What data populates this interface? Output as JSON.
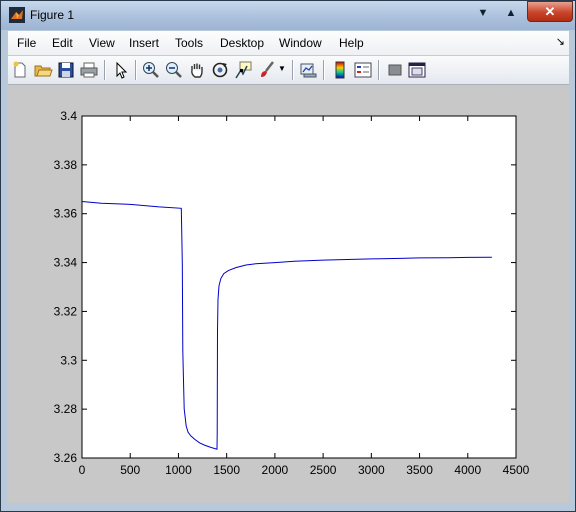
{
  "window": {
    "title": "Figure 1"
  },
  "menu": [
    "File",
    "Edit",
    "View",
    "Insert",
    "Tools",
    "Desktop",
    "Window",
    "Help"
  ],
  "toolbar": {
    "icons": [
      "new-figure-icon",
      "open-file-icon",
      "save-icon",
      "print-icon",
      "pointer-icon",
      "zoom-in-icon",
      "zoom-out-icon",
      "pan-hand-icon",
      "rotate-3d-icon",
      "data-cursor-icon",
      "brush-icon",
      "brush-dropdown-icon",
      "link-plot-icon",
      "insert-colorbar-icon",
      "insert-legend-icon",
      "hide-plot-tools-icon",
      "show-plot-tools-icon"
    ]
  },
  "colors": {
    "line": "#0000cc",
    "figure_bg": "#c8c8c8",
    "axes_bg": "#ffffff"
  },
  "chart_data": {
    "type": "line",
    "xlim": [
      0,
      4500
    ],
    "ylim": [
      3.26,
      3.4
    ],
    "xticks": [
      "0",
      "500",
      "1000",
      "1500",
      "2000",
      "2500",
      "3000",
      "3500",
      "4000",
      "4500"
    ],
    "yticks": [
      "3.26",
      "3.28",
      "3.3",
      "3.32",
      "3.34",
      "3.36",
      "3.38",
      "3.4"
    ],
    "grid": false,
    "series": [
      {
        "x": [
          0,
          200,
          500,
          800,
          1030,
          1040,
          1045,
          1050,
          1060,
          1080,
          1100,
          1130,
          1170,
          1220,
          1280,
          1340,
          1400,
          1402,
          1405,
          1410,
          1420,
          1440,
          1470,
          1520,
          1600,
          1700,
          1800,
          2000,
          2200,
          2500,
          2800,
          3000,
          3300,
          3500,
          3800,
          4000,
          4250
        ],
        "y": [
          3.365,
          3.3643,
          3.3638,
          3.3628,
          3.3622,
          3.34,
          3.304,
          3.295,
          3.28,
          3.273,
          3.2705,
          3.269,
          3.2676,
          3.2662,
          3.2651,
          3.2643,
          3.2636,
          3.27,
          3.312,
          3.325,
          3.3305,
          3.3335,
          3.3355,
          3.3368,
          3.338,
          3.339,
          3.3395,
          3.34,
          3.3405,
          3.341,
          3.3413,
          3.3415,
          3.3417,
          3.3419,
          3.342,
          3.3421,
          3.3422
        ]
      }
    ]
  }
}
